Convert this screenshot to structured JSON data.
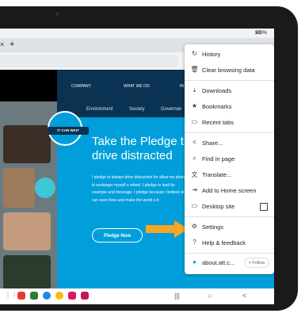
{
  "status": {
    "signal": "5G",
    "battery": "100%"
  },
  "tab": {
    "close": "×",
    "new": "+"
  },
  "site_nav": {
    "company": "COMPANY",
    "what_we_do": "WHAT WE DO",
    "cut": "IN"
  },
  "site_sub": {
    "environment": "Environment",
    "society": "Society",
    "governance": "Governan"
  },
  "logo_text": "IT CAN WAIT",
  "hero": {
    "title_line1": "Take the Pledge t",
    "title_line2": "drive distracted",
    "body": "I pledge to always drive distraction fre allow my phone to endanger myself o wheel. I pledge to lead by example and message. I pledge because I believe dr can save lives and make the world a b",
    "button": "Pledge Now"
  },
  "menu": {
    "items": [
      {
        "icon": "↻",
        "label": "History"
      },
      {
        "icon": "🗑",
        "label": "Clear browsing data"
      },
      {
        "icon": "⤓",
        "label": "Downloads"
      },
      {
        "icon": "★",
        "label": "Bookmarks"
      },
      {
        "icon": "▭",
        "label": "Recent tabs"
      },
      {
        "icon": "<",
        "label": "Share..."
      },
      {
        "icon": "⌕",
        "label": "Find in page"
      },
      {
        "icon": "文",
        "label": "Translate..."
      },
      {
        "icon": "⇥",
        "label": "Add to Home screen"
      },
      {
        "icon": "▭",
        "label": "Desktop site"
      },
      {
        "icon": "⚙",
        "label": "Settings"
      },
      {
        "icon": "?",
        "label": "Help & feedback"
      }
    ],
    "footer": {
      "site": "about.att.c...",
      "follow": "+ Follow"
    }
  },
  "colors": {
    "att_blue": "#009fdb",
    "att_navy": "#0a3253",
    "arrow": "#f5a623"
  },
  "navkeys": {
    "recents": "|||",
    "home": "○",
    "back": "<"
  }
}
